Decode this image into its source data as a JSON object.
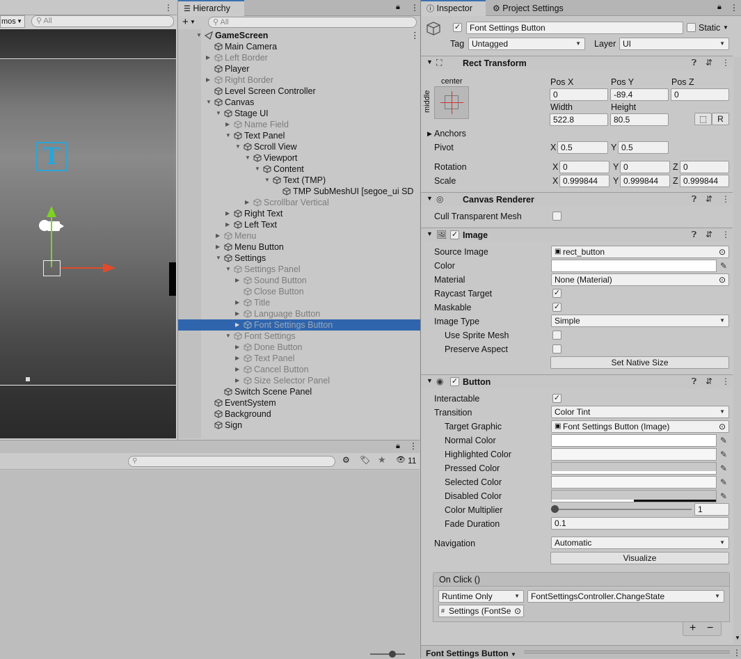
{
  "scene": {
    "gizmos_label": "mos",
    "search_placeholder": "All"
  },
  "hierarchy": {
    "tab": "Hierarchy",
    "search_placeholder": "All",
    "items": [
      {
        "label": "GameScreen",
        "depth": 0,
        "state": "normal",
        "bold": true,
        "expand": "open"
      },
      {
        "label": "Main Camera",
        "depth": 1,
        "state": "normal",
        "expand": "none"
      },
      {
        "label": "Left Border",
        "depth": 1,
        "state": "dim",
        "expand": "closed"
      },
      {
        "label": "Player",
        "depth": 1,
        "state": "normal",
        "expand": "none"
      },
      {
        "label": "Right Border",
        "depth": 1,
        "state": "dim",
        "expand": "closed"
      },
      {
        "label": "Level Screen Controller",
        "depth": 1,
        "state": "normal",
        "expand": "none"
      },
      {
        "label": "Canvas",
        "depth": 1,
        "state": "normal",
        "expand": "open"
      },
      {
        "label": "Stage UI",
        "depth": 2,
        "state": "normal",
        "expand": "open"
      },
      {
        "label": "Name Field",
        "depth": 3,
        "state": "dim",
        "expand": "closed"
      },
      {
        "label": "Text Panel",
        "depth": 3,
        "state": "normal",
        "expand": "open"
      },
      {
        "label": "Scroll View",
        "depth": 4,
        "state": "normal",
        "expand": "open"
      },
      {
        "label": "Viewport",
        "depth": 5,
        "state": "normal",
        "expand": "open"
      },
      {
        "label": "Content",
        "depth": 6,
        "state": "normal",
        "expand": "open"
      },
      {
        "label": "Text (TMP)",
        "depth": 7,
        "state": "normal",
        "expand": "open"
      },
      {
        "label": "TMP SubMeshUI [segoe_ui SD",
        "depth": 8,
        "state": "normal",
        "expand": "none"
      },
      {
        "label": "Scrollbar Vertical",
        "depth": 5,
        "state": "dim",
        "expand": "closed"
      },
      {
        "label": "Right Text",
        "depth": 3,
        "state": "normal",
        "expand": "closed"
      },
      {
        "label": "Left Text",
        "depth": 3,
        "state": "normal",
        "expand": "closed"
      },
      {
        "label": "Menu",
        "depth": 2,
        "state": "dim",
        "expand": "closed"
      },
      {
        "label": "Menu Button",
        "depth": 2,
        "state": "normal",
        "expand": "closed"
      },
      {
        "label": "Settings",
        "depth": 2,
        "state": "normal",
        "expand": "open"
      },
      {
        "label": "Settings Panel",
        "depth": 3,
        "state": "dim",
        "expand": "open"
      },
      {
        "label": "Sound Button",
        "depth": 4,
        "state": "dim",
        "expand": "closed"
      },
      {
        "label": "Close Button",
        "depth": 4,
        "state": "dim",
        "expand": "none"
      },
      {
        "label": "Title",
        "depth": 4,
        "state": "dim",
        "expand": "closed"
      },
      {
        "label": "Language Button",
        "depth": 4,
        "state": "dim",
        "expand": "closed"
      },
      {
        "label": "Font Settings Button",
        "depth": 4,
        "state": "selected",
        "expand": "closed"
      },
      {
        "label": "Font Settings",
        "depth": 3,
        "state": "dim",
        "expand": "open"
      },
      {
        "label": "Done Button",
        "depth": 4,
        "state": "dim",
        "expand": "closed"
      },
      {
        "label": "Text Panel",
        "depth": 4,
        "state": "dim",
        "expand": "closed"
      },
      {
        "label": "Cancel Button",
        "depth": 4,
        "state": "dim",
        "expand": "closed"
      },
      {
        "label": "Size Selector Panel",
        "depth": 4,
        "state": "dim",
        "expand": "closed"
      },
      {
        "label": "Switch Scene Panel",
        "depth": 2,
        "state": "normal",
        "expand": "none"
      },
      {
        "label": "EventSystem",
        "depth": 1,
        "state": "normal",
        "expand": "none"
      },
      {
        "label": "Background",
        "depth": 1,
        "state": "normal",
        "expand": "none"
      },
      {
        "label": "Sign",
        "depth": 1,
        "state": "normal",
        "expand": "none"
      }
    ]
  },
  "project": {
    "hidden_count": "11"
  },
  "inspector": {
    "tabs": [
      "Inspector",
      "Project Settings"
    ],
    "object_name": "Font Settings Button",
    "static_label": "Static",
    "tag_label": "Tag",
    "tag_value": "Untagged",
    "layer_label": "Layer",
    "layer_value": "UI",
    "rect": {
      "title": "Rect Transform",
      "anchor_h": "center",
      "anchor_v": "middle",
      "posx_label": "Pos X",
      "posy_label": "Pos Y",
      "posz_label": "Pos Z",
      "posx": "0",
      "posy": "-89.4",
      "posz": "0",
      "width_label": "Width",
      "height_label": "Height",
      "width": "522.8",
      "height": "80.5",
      "r_btn": "R",
      "anchors_label": "Anchors",
      "pivot_label": "Pivot",
      "pivot_x": "0.5",
      "pivot_y": "0.5",
      "rotation_label": "Rotation",
      "rot_x": "0",
      "rot_y": "0",
      "rot_z": "0",
      "scale_label": "Scale",
      "scale_x": "0.999844",
      "scale_y": "0.999844",
      "scale_z": "0.999844",
      "x": "X",
      "y": "Y",
      "z": "Z"
    },
    "canvas_renderer": {
      "title": "Canvas Renderer",
      "cull_label": "Cull Transparent Mesh"
    },
    "image": {
      "title": "Image",
      "source_label": "Source Image",
      "source_value": "rect_button",
      "color_label": "Color",
      "material_label": "Material",
      "material_value": "None (Material)",
      "raycast_label": "Raycast Target",
      "maskable_label": "Maskable",
      "type_label": "Image Type",
      "type_value": "Simple",
      "sprite_mesh_label": "Use Sprite Mesh",
      "preserve_label": "Preserve Aspect",
      "native_btn": "Set Native Size"
    },
    "button": {
      "title": "Button",
      "interactable_label": "Interactable",
      "transition_label": "Transition",
      "transition_value": "Color Tint",
      "target_label": "Target Graphic",
      "target_value": "Font Settings Button (Image)",
      "normal_label": "Normal Color",
      "highlighted_label": "Highlighted Color",
      "pressed_label": "Pressed Color",
      "selected_label": "Selected Color",
      "disabled_label": "Disabled Color",
      "multiplier_label": "Color Multiplier",
      "multiplier_value": "1",
      "fade_label": "Fade Duration",
      "fade_value": "0.1",
      "nav_label": "Navigation",
      "nav_value": "Automatic",
      "visualize_btn": "Visualize",
      "onclick_label": "On Click ()",
      "runtime_value": "Runtime Only",
      "function_value": "FontSettingsController.ChangeState",
      "object_value": "Settings (FontSe",
      "plus": "+",
      "minus": "−"
    },
    "footer": {
      "label": "Font Settings Button"
    }
  }
}
